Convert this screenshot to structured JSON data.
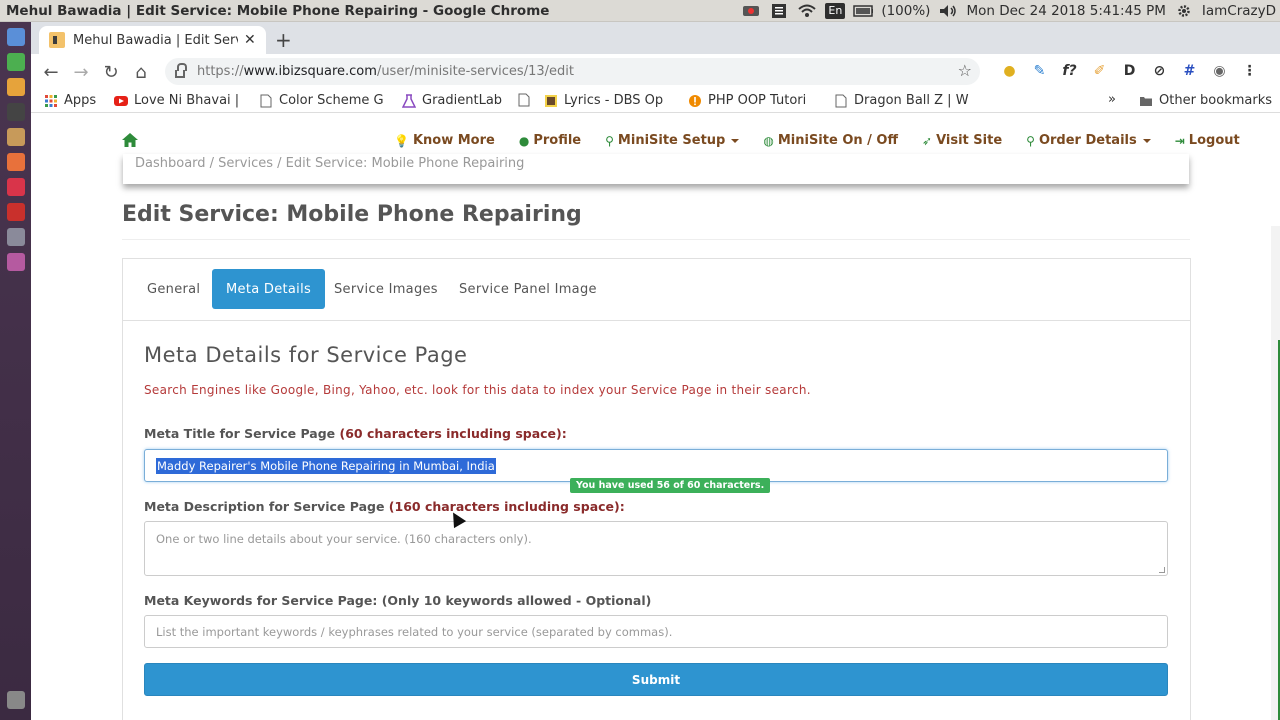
{
  "os": {
    "window_title": "Mehul Bawadia | Edit Service: Mobile Phone Repairing - Google Chrome",
    "battery": "(100%)",
    "datetime": "Mon Dec 24 2018  5:41:45 PM",
    "user": "IamCrazyD",
    "keyboard": "En"
  },
  "browser": {
    "tab_title": "Mehul Bawadia | Edit Serv",
    "url_proto": "https://",
    "url_host": "www.ibizsquare.com",
    "url_path": "/user/minisite-services/13/edit",
    "bookmarks": [
      {
        "label": "Apps"
      },
      {
        "label": "Love Ni Bhavai |"
      },
      {
        "label": "Color Scheme G"
      },
      {
        "label": "GradientLab"
      },
      {
        "label": ""
      },
      {
        "label": "Lyrics - DBS Op"
      },
      {
        "label": "PHP OOP Tutori"
      },
      {
        "label": "Dragon Ball Z | W"
      }
    ],
    "other_bookmarks": "Other bookmarks",
    "more_bookmarks": "»"
  },
  "site_nav": {
    "items": [
      {
        "label": "Know More"
      },
      {
        "label": "Profile"
      },
      {
        "label": "MiniSite Setup"
      },
      {
        "label": "MiniSite On / Off"
      },
      {
        "label": "Visit Site"
      },
      {
        "label": "Order Details"
      },
      {
        "label": "Logout"
      }
    ]
  },
  "breadcrumb": "Dashboard  /  Services  /  Edit Service: Mobile Phone Repairing",
  "page": {
    "title": "Edit Service: Mobile Phone Repairing",
    "tabs": [
      "General",
      "Meta Details",
      "Service Images",
      "Service Panel Image"
    ],
    "section_title": "Meta Details for Service Page",
    "section_note": "Search Engines like Google, Bing, Yahoo, etc. look for this data to index your Service Page in their search.",
    "meta_title_label": "Meta Title for Service Page ",
    "meta_title_req": "(60 characters including space):",
    "meta_title_value": "Maddy Repairer's Mobile Phone Repairing in Mumbai, India",
    "count_badge": "You have used 56 of 60 characters.",
    "meta_desc_label": "Meta Description for Service Page ",
    "meta_desc_req": "(160 characters including space):",
    "meta_desc_placeholder": "One or two line details about your service. (160 characters only).",
    "meta_kw_label": "Meta Keywords for Service Page: (Only 10 keywords allowed - Optional)",
    "meta_kw_placeholder": "List the important keywords / keyphrases related to your service (separated by commas).",
    "submit_label": "Submit"
  }
}
